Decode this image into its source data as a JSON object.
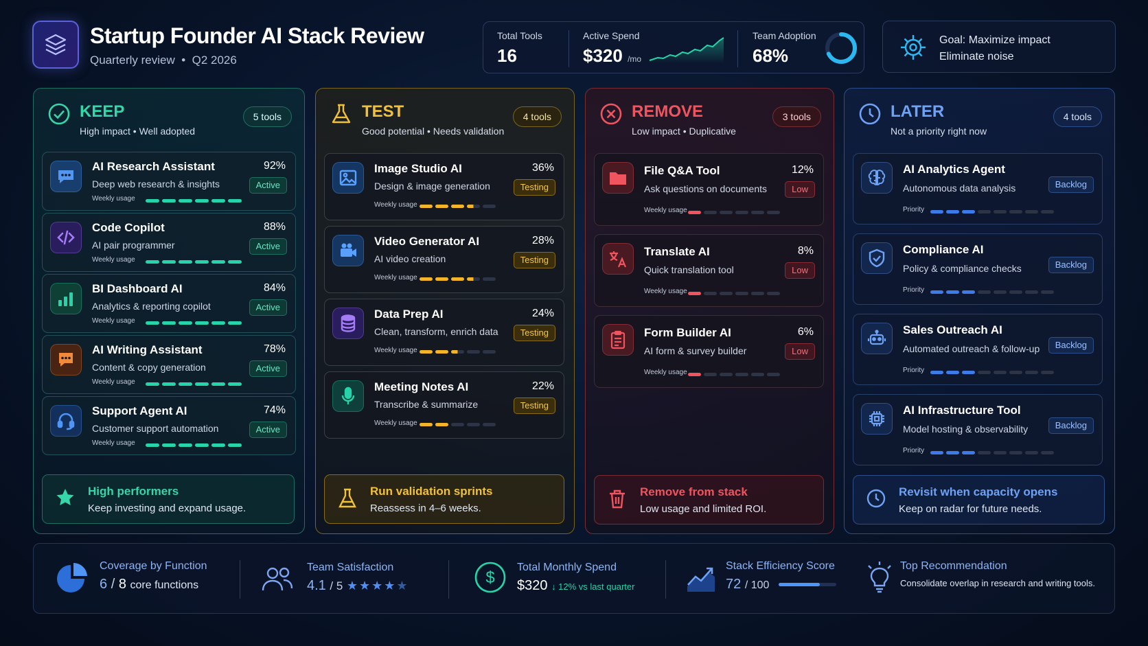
{
  "header": {
    "title": "Startup Founder AI Stack Review",
    "subtitle_prefix": "Quarterly review",
    "subtitle_sep": "•",
    "subtitle_period": "Q2 2026",
    "total_tools_label": "Total Tools",
    "total_tools": "16",
    "spend_label": "Active Spend",
    "spend": "$320",
    "spend_unit": "/mo",
    "adoption_label": "Team Adoption",
    "adoption": "68%",
    "adoption_fraction": 0.68,
    "goal_line1": "Goal: Maximize impact",
    "goal_line2": "Eliminate noise"
  },
  "columns": {
    "keep": {
      "title": "KEEP",
      "subtitle": "High impact • Well adopted",
      "badge": "5 tools",
      "color": "#35d6a8",
      "usage_label": "Weekly usage",
      "items": [
        {
          "name": "AI Research Assistant",
          "desc": "Deep web research & insights",
          "pct": "92%",
          "status": "Active",
          "icon": "chat-icon",
          "usage": 6
        },
        {
          "name": "Code Copilot",
          "desc": "AI pair programmer",
          "pct": "88%",
          "status": "Active",
          "icon": "code-icon",
          "usage": 6
        },
        {
          "name": "BI Dashboard AI",
          "desc": "Analytics & reporting copilot",
          "pct": "84%",
          "status": "Active",
          "icon": "bar-chart-icon",
          "usage": 6
        },
        {
          "name": "AI Writing Assistant",
          "desc": "Content & copy generation",
          "pct": "78%",
          "status": "Active",
          "icon": "writing-chat-icon",
          "usage": 6
        },
        {
          "name": "Support Agent AI",
          "desc": "Customer support automation",
          "pct": "74%",
          "status": "Active",
          "icon": "headset-icon",
          "usage": 6
        }
      ],
      "footer_title": "High performers",
      "footer_desc": "Keep investing and expand usage."
    },
    "test": {
      "title": "TEST",
      "subtitle": "Good potential • Needs validation",
      "badge": "4 tools",
      "color": "#f2c13a",
      "usage_label": "Weekly usage",
      "items": [
        {
          "name": "Image Studio AI",
          "desc": "Design & image generation",
          "pct": "36%",
          "status": "Testing",
          "icon": "image-icon",
          "usage": 3.5
        },
        {
          "name": "Video Generator AI",
          "desc": "AI video creation",
          "pct": "28%",
          "status": "Testing",
          "icon": "video-camera-icon",
          "usage": 3.5
        },
        {
          "name": "Data Prep AI",
          "desc": "Clean, transform, enrich data",
          "pct": "24%",
          "status": "Testing",
          "icon": "database-icon",
          "usage": 2.5
        },
        {
          "name": "Meeting Notes AI",
          "desc": "Transcribe & summarize",
          "pct": "22%",
          "status": "Testing",
          "icon": "microphone-icon",
          "usage": 2
        }
      ],
      "footer_title": "Run validation sprints",
      "footer_desc": "Reassess in 4–6 weeks."
    },
    "remove": {
      "title": "REMOVE",
      "subtitle": "Low impact • Duplicative",
      "badge": "3 tools",
      "color": "#f0545e",
      "usage_label": "Weekly usage",
      "items": [
        {
          "name": "File Q&A Tool",
          "desc": "Ask questions on documents",
          "pct": "12%",
          "status": "Low",
          "icon": "folder-icon",
          "usage": 1
        },
        {
          "name": "Translate AI",
          "desc": "Quick translation tool",
          "pct": "8%",
          "status": "Low",
          "icon": "translate-icon",
          "usage": 1
        },
        {
          "name": "Form Builder AI",
          "desc": "AI form & survey builder",
          "pct": "6%",
          "status": "Low",
          "icon": "clipboard-icon",
          "usage": 1
        }
      ],
      "footer_title": "Remove from stack",
      "footer_desc": "Low usage and limited ROI."
    },
    "later": {
      "title": "LATER",
      "subtitle": "Not a priority right now",
      "badge": "4 tools",
      "color": "#6ea2f5",
      "usage_label": "Priority",
      "items": [
        {
          "name": "AI Analytics Agent",
          "desc": "Autonomous data analysis",
          "status": "Backlog",
          "icon": "brain-icon",
          "usage": 3
        },
        {
          "name": "Compliance AI",
          "desc": "Policy & compliance checks",
          "status": "Backlog",
          "icon": "shield-icon",
          "usage": 3
        },
        {
          "name": "Sales Outreach AI",
          "desc": "Automated outreach & follow-up",
          "status": "Backlog",
          "icon": "robot-icon",
          "usage": 3
        },
        {
          "name": "AI Infrastructure Tool",
          "desc": "Model hosting & observability",
          "status": "Backlog",
          "icon": "chip-icon",
          "usage": 3
        }
      ],
      "footer_title": "Revisit when capacity opens",
      "footer_desc": "Keep on radar for future needs."
    }
  },
  "bottom": {
    "coverage_label": "Coverage by Function",
    "coverage_num": "6",
    "coverage_sep": "/",
    "coverage_den": "8",
    "coverage_unit": "core functions",
    "satisfaction_label": "Team Satisfaction",
    "satisfaction_num": "4.1",
    "satisfaction_den": "/ 5",
    "satisfaction_rating": 4.5,
    "spend_label": "Total Monthly Spend",
    "spend": "$320",
    "spend_change": "↓ 12% vs last quarter",
    "efficiency_label": "Stack Efficiency Score",
    "efficiency_num": "72",
    "efficiency_den": "/ 100",
    "efficiency_fraction": 0.72,
    "rec_label": "Top Recommendation",
    "rec_text": "Consolidate overlap in research and writing tools."
  }
}
